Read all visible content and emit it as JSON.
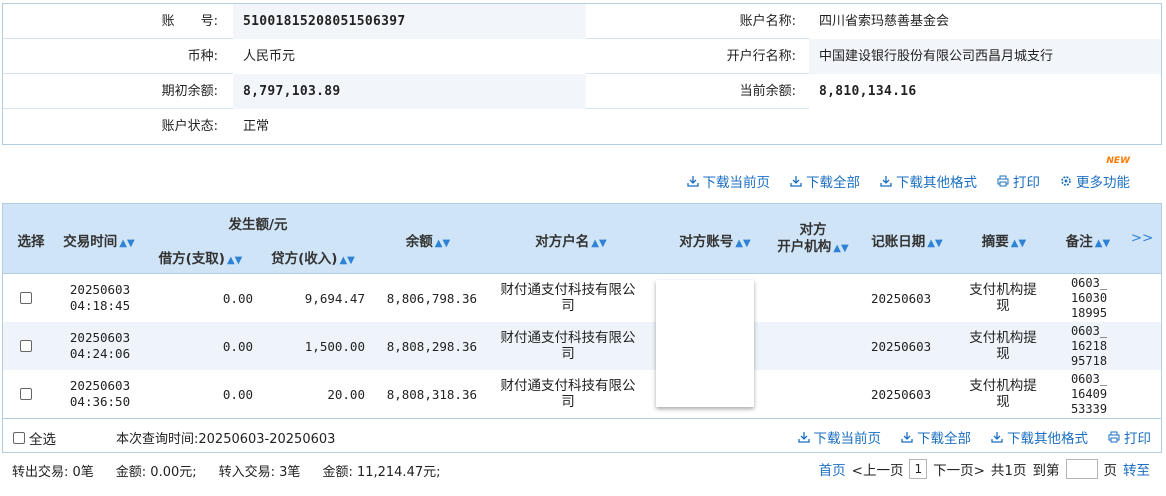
{
  "account": {
    "number_label": "账　　号:",
    "number": "51001815208051506397",
    "name_label": "账户名称:",
    "name": "四川省索玛慈善基金会",
    "currency_label": "币种:",
    "currency": "人民币元",
    "bank_label": "开户行名称:",
    "bank": "中国建设银行股份有限公司西昌月城支行",
    "opening_balance_label": "期初余额:",
    "opening_balance": "8,797,103.89",
    "current_balance_label": "当前余额:",
    "current_balance": "8,810,134.16",
    "status_label": "账户状态:",
    "status": "正常"
  },
  "toolbar": {
    "download_page": "下载当前页",
    "download_all": "下载全部",
    "download_other": "下载其他格式",
    "print": "打印",
    "more": "更多功能",
    "new_badge": "NEW"
  },
  "table": {
    "headers": {
      "select": "选择",
      "time": "交易时间",
      "amount_group": "发生额/元",
      "debit": "借方(支取)",
      "credit": "贷方(收入)",
      "balance": "余额",
      "counterparty_name": "对方户名",
      "counterparty_account": "对方账号",
      "counterparty_bank_1": "对方",
      "counterparty_bank_2": "开户机构",
      "booking_date": "记账日期",
      "summary": "摘要",
      "remark": "备注",
      "more": ">>"
    },
    "rows": [
      {
        "date": "20250603",
        "time": "04:18:45",
        "debit": "0.00",
        "credit": "9,694.47",
        "balance": "8,806,798.36",
        "cp_name_1": "财付通支付科技有限公",
        "cp_name_2": "司",
        "booking": "20250603",
        "summary_1": "支付机构提",
        "summary_2": "现",
        "remark_1": "0603_",
        "remark_2": "16030",
        "remark_3": "18995"
      },
      {
        "date": "20250603",
        "time": "04:24:06",
        "debit": "0.00",
        "credit": "1,500.00",
        "balance": "8,808,298.36",
        "cp_name_1": "财付通支付科技有限公",
        "cp_name_2": "司",
        "booking": "20250603",
        "summary_1": "支付机构提",
        "summary_2": "现",
        "remark_1": "0603_",
        "remark_2": "16218",
        "remark_3": "95718"
      },
      {
        "date": "20250603",
        "time": "04:36:50",
        "debit": "0.00",
        "credit": "20.00",
        "balance": "8,808,318.36",
        "cp_name_1": "财付通支付科技有限公",
        "cp_name_2": "司",
        "booking": "20250603",
        "summary_1": "支付机构提",
        "summary_2": "现",
        "remark_1": "0603_",
        "remark_2": "16409",
        "remark_3": "53339"
      }
    ]
  },
  "footer": {
    "select_all": "全选",
    "query_time": "本次查询时间:20250603-20250603",
    "download_page": "下载当前页",
    "download_all": "下载全部",
    "download_other": "下载其他格式",
    "print": "打印"
  },
  "summary": {
    "out_tx": "转出交易: 0笔",
    "out_amount": "金额: 0.00元;",
    "in_tx": "转入交易: 3笔",
    "in_amount": "金额: 11,214.47元;"
  },
  "pager": {
    "first": "首页",
    "prev": "<上一页",
    "current": "1",
    "next": "下一页>",
    "total": "共1页",
    "to_page": "到第",
    "page_unit": "页",
    "go": "转至"
  },
  "colors": {
    "link": "#1b6fc2",
    "header_bg": "#cfe4f7",
    "row_alt_bg": "#eef4fa",
    "border": "#b5cde3",
    "new_badge": "#ff7a00"
  }
}
